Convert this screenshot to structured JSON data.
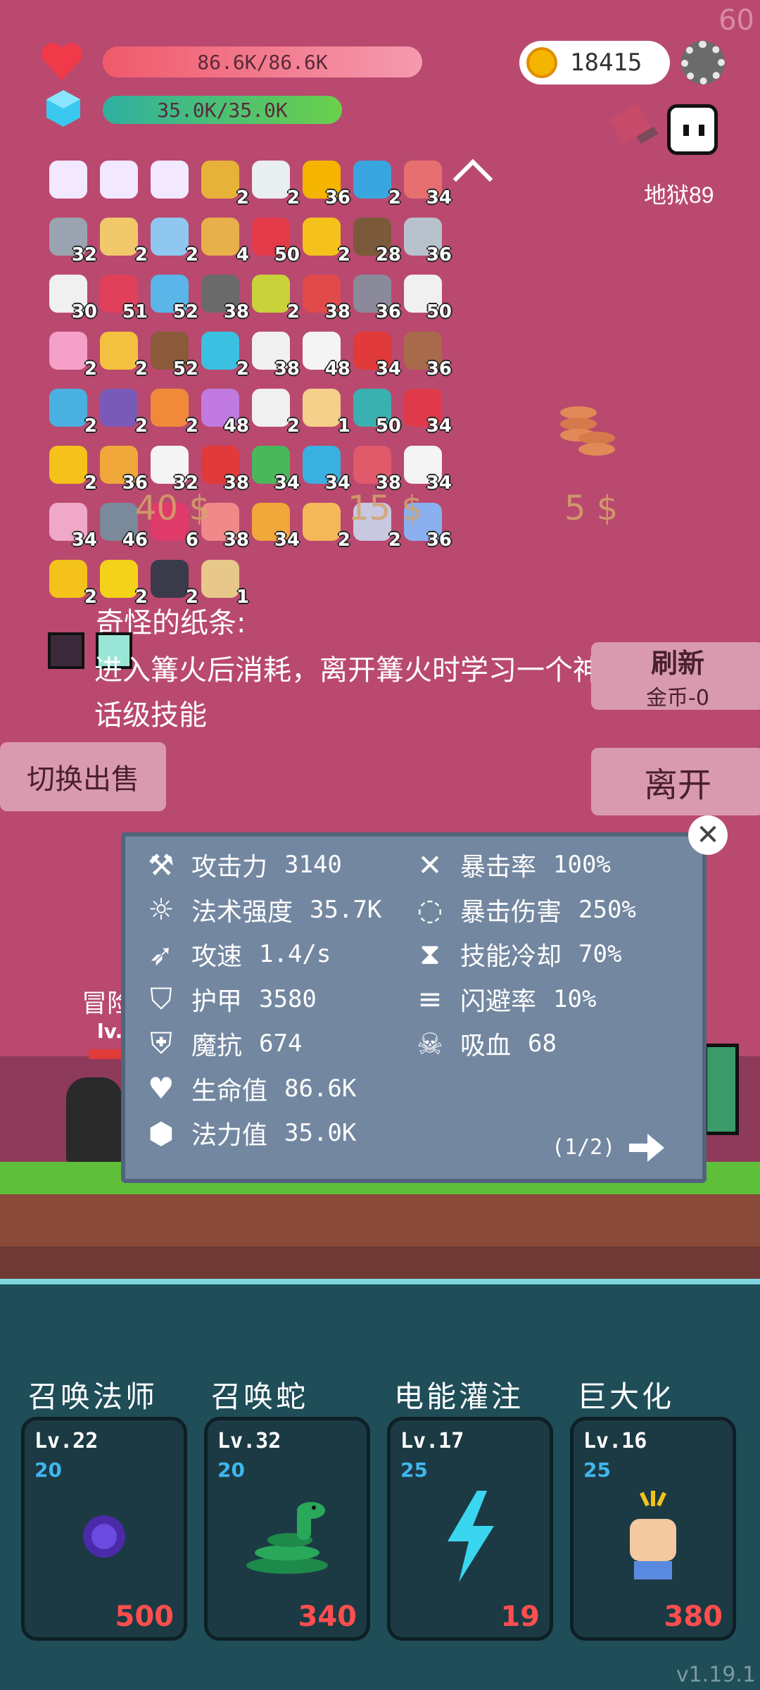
{
  "fps": "60",
  "hp": {
    "text": "86.6K/86.6K",
    "fill": 1.0,
    "color": "#f06b84"
  },
  "mp": {
    "text": "35.0K/35.0K",
    "fill": 1.0,
    "color": "#44c88c"
  },
  "gold": "18415",
  "difficulty": "地狱89",
  "inventory": [
    {
      "icon": "scroll-icon",
      "count": "",
      "color": "#f2e8ff"
    },
    {
      "icon": "scroll-icon",
      "count": "",
      "color": "#f2e8ff"
    },
    {
      "icon": "scroll-icon",
      "count": "",
      "color": "#f2e8ff"
    },
    {
      "icon": "pineapple-icon",
      "count": "2",
      "color": "#e7b23a"
    },
    {
      "icon": "cards-icon",
      "count": "2",
      "color": "#e9eef0"
    },
    {
      "icon": "coin-stack-icon",
      "count": "36",
      "color": "#f4b400"
    },
    {
      "icon": "ticket-icon",
      "count": "2",
      "color": "#3aa6e0"
    },
    {
      "icon": "rainbow-icon",
      "count": "34",
      "color": "#e76f6f"
    },
    {
      "icon": "axe-icon",
      "count": "32",
      "color": "#9aa4b0"
    },
    {
      "icon": "scroll-icon",
      "count": "2",
      "color": "#f1c86a"
    },
    {
      "icon": "shirt-icon",
      "count": "2",
      "color": "#8fc7f0"
    },
    {
      "icon": "parchment-icon",
      "count": "4",
      "color": "#e8b04a"
    },
    {
      "icon": "heart-icon",
      "count": "50",
      "color": "#e53a4a"
    },
    {
      "icon": "crown-icon",
      "count": "2",
      "color": "#f4c21a"
    },
    {
      "icon": "coconut-icon",
      "count": "28",
      "color": "#7a5a3a"
    },
    {
      "icon": "sword-icon",
      "count": "36",
      "color": "#b8c2cc"
    },
    {
      "icon": "pill-icon",
      "count": "30",
      "color": "#f0f0f0"
    },
    {
      "icon": "jar-icon",
      "count": "51",
      "color": "#e0405a"
    },
    {
      "icon": "orb-icon",
      "count": "52",
      "color": "#5ab6e8"
    },
    {
      "icon": "bomb-icon",
      "count": "38",
      "color": "#6a6a6a"
    },
    {
      "icon": "egg-icon",
      "count": "2",
      "color": "#c8d23a"
    },
    {
      "icon": "watermelon-icon",
      "count": "38",
      "color": "#e04a4a"
    },
    {
      "icon": "tombstone-icon",
      "count": "36",
      "color": "#8a8a9a"
    },
    {
      "icon": "flag-icon",
      "count": "50",
      "color": "#f0f0f0"
    },
    {
      "icon": "icecream-icon",
      "count": "2",
      "color": "#f4a0c8"
    },
    {
      "icon": "beer-icon",
      "count": "2",
      "color": "#f4c040"
    },
    {
      "icon": "ship-icon",
      "count": "52",
      "color": "#8a5a3a"
    },
    {
      "icon": "spiral-icon",
      "count": "2",
      "color": "#3ac0e0"
    },
    {
      "icon": "flower-icon",
      "count": "38",
      "color": "#f0f0f0"
    },
    {
      "icon": "ghost-icon",
      "count": "48",
      "color": "#f4f4f4"
    },
    {
      "icon": "red-card-icon",
      "count": "34",
      "color": "#e03a3a"
    },
    {
      "icon": "shield-round-icon",
      "count": "36",
      "color": "#a86a4a"
    },
    {
      "icon": "molecule-icon",
      "count": "2",
      "color": "#4ab0e0"
    },
    {
      "icon": "wizard-hat-icon",
      "count": "2",
      "color": "#7a5ab8"
    },
    {
      "icon": "briefcase-icon",
      "count": "2",
      "color": "#f08a3a"
    },
    {
      "icon": "tulip-icon",
      "count": "48",
      "color": "#c07ae0"
    },
    {
      "icon": "network-icon",
      "count": "2",
      "color": "#f0f0f0"
    },
    {
      "icon": "map-icon",
      "count": "1",
      "color": "#f4d08a"
    },
    {
      "icon": "disc-icon",
      "count": "50",
      "color": "#3ab0b0"
    },
    {
      "icon": "strawberry-icon",
      "count": "34",
      "color": "#e03a4a"
    },
    {
      "icon": "sunflower-icon",
      "count": "2",
      "color": "#f4c21a"
    },
    {
      "icon": "book-icon",
      "count": "36",
      "color": "#f0a83a"
    },
    {
      "icon": "dice-icon",
      "count": "32",
      "color": "#f4f4f4"
    },
    {
      "icon": "apple-icon",
      "count": "38",
      "color": "#e03a3a"
    },
    {
      "icon": "cash-icon",
      "count": "34",
      "color": "#4ab85a"
    },
    {
      "icon": "pen-icon",
      "count": "34",
      "color": "#3ab0e0"
    },
    {
      "icon": "sock-icon",
      "count": "38",
      "color": "#e05a6a"
    },
    {
      "icon": "envelope-icon",
      "count": "34",
      "color": "#f4f4f4"
    },
    {
      "icon": "spray-icon",
      "count": "34",
      "color": "#f0a8c8"
    },
    {
      "icon": "spiky-ball-icon",
      "count": "46",
      "color": "#7a8a9a"
    },
    {
      "icon": "gem-icon",
      "count": "6",
      "color": "#e03a6a"
    },
    {
      "icon": "meat-icon",
      "count": "38",
      "color": "#f08a8a"
    },
    {
      "icon": "bread-icon",
      "count": "34",
      "color": "#f0a83a"
    },
    {
      "icon": "note-icon",
      "count": "2",
      "color": "#f4b85a"
    },
    {
      "icon": "unicorn-icon",
      "count": "2",
      "color": "#c8c8e0"
    },
    {
      "icon": "capsule-icon",
      "count": "36",
      "color": "#8ab0f0"
    },
    {
      "icon": "magic-wand-icon",
      "count": "2",
      "color": "#f4c21a"
    },
    {
      "icon": "sun-icon",
      "count": "2",
      "color": "#f4d21a"
    },
    {
      "icon": "cauldron-icon",
      "count": "2",
      "color": "#3a3a4a"
    },
    {
      "icon": "old-map-icon",
      "count": "1",
      "color": "#e8c88a"
    }
  ],
  "description": {
    "title": "奇怪的纸条:",
    "text": "进入篝火后消耗，离开篝火时学习一个神话级技能"
  },
  "shop": {
    "prices": [
      "40 $",
      "15 $",
      "5 $"
    ],
    "refresh_label": "刷新",
    "refresh_cost": "金币-0",
    "switch_sell_label": "切换出售",
    "leave_label": "离开"
  },
  "stats": {
    "left": [
      {
        "icon": "axe-icon",
        "label": "攻击力",
        "value": "3140"
      },
      {
        "icon": "sun-icon",
        "label": "法术强度",
        "value": "35.7K"
      },
      {
        "icon": "bow-icon",
        "label": "攻速",
        "value": "1.4/s"
      },
      {
        "icon": "shield-icon",
        "label": "护甲",
        "value": "3580"
      },
      {
        "icon": "magic-shield-icon",
        "label": "魔抗",
        "value": "674"
      },
      {
        "icon": "heart-icon",
        "label": "生命值",
        "value": "86.6K"
      },
      {
        "icon": "crystal-icon",
        "label": "法力值",
        "value": "35.0K"
      }
    ],
    "right": [
      {
        "icon": "crit-icon",
        "label": "暴击率",
        "value": "100%"
      },
      {
        "icon": "crit-damage-icon",
        "label": "暴击伤害",
        "value": "250%"
      },
      {
        "icon": "hourglass-icon",
        "label": "技能冷却",
        "value": "70%"
      },
      {
        "icon": "dodge-icon",
        "label": "闪避率",
        "value": "10%"
      },
      {
        "icon": "vampire-skull-icon",
        "label": "吸血",
        "value": "68"
      }
    ],
    "page": "(1/2)"
  },
  "behind_panel_text": {
    "name": "冒险",
    "lv": "lv."
  },
  "skills": [
    {
      "name": "召唤法师",
      "level": "Lv.22",
      "cost": "20",
      "damage": "500",
      "icon": "dark-orb-icon"
    },
    {
      "name": "召唤蛇",
      "level": "Lv.32",
      "cost": "20",
      "damage": "340",
      "icon": "snake-icon"
    },
    {
      "name": "电能灌注",
      "level": "Lv.17",
      "cost": "25",
      "damage": "19",
      "icon": "lightning-icon"
    },
    {
      "name": "巨大化",
      "level": "Lv.16",
      "cost": "25",
      "damage": "380",
      "icon": "fist-icon"
    }
  ],
  "version": "v1.19.1"
}
